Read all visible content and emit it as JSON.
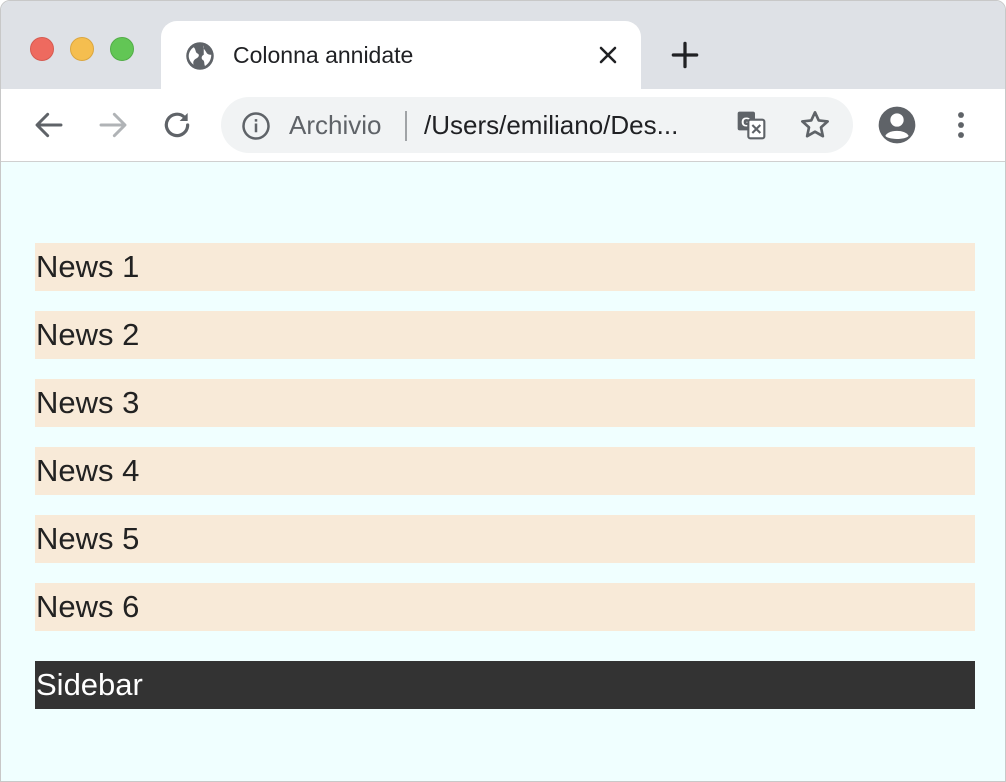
{
  "window": {
    "tab": {
      "title": "Colonna annidate"
    },
    "omnibox": {
      "origin_label": "Archivio",
      "url": "/Users/emiliano/Des..."
    }
  },
  "page": {
    "news_items": [
      "News 1",
      "News 2",
      "News 3",
      "News 4",
      "News 5",
      "News 6"
    ],
    "sidebar_label": "Sidebar"
  },
  "colors": {
    "page_background": "#f0ffff",
    "news_background": "#f8ead8",
    "sidebar_background": "#333333",
    "sidebar_text": "#ffffff"
  }
}
